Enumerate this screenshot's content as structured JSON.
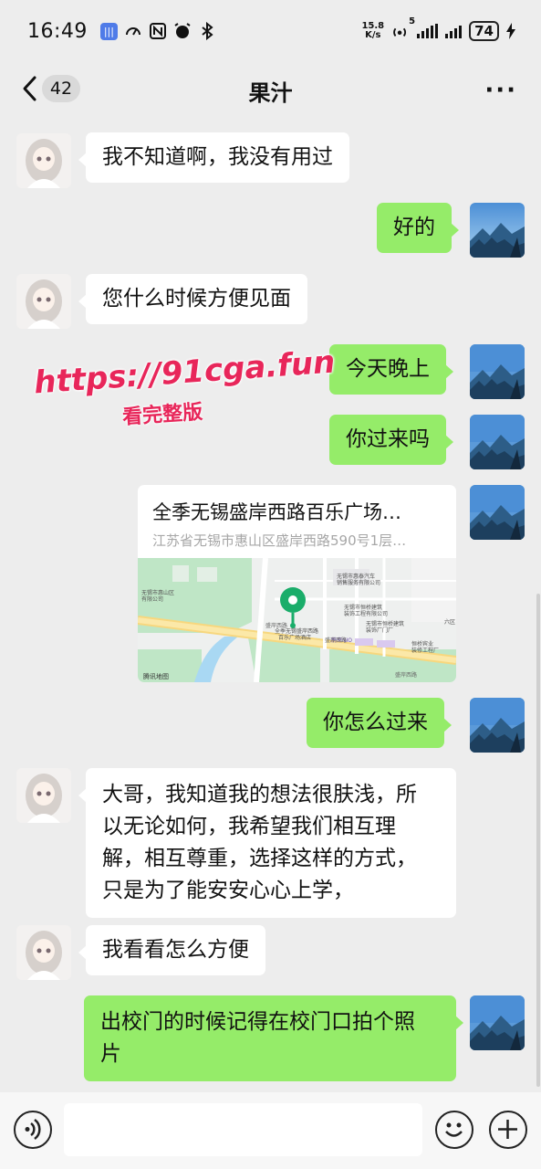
{
  "status_bar": {
    "time": "16:49",
    "net_speed_value": "15.8",
    "net_speed_unit": "K/s",
    "hotspot_count": "5",
    "battery": "74"
  },
  "title_bar": {
    "unread_count": "42",
    "chat_name": "果汁",
    "more_label": "···"
  },
  "messages": [
    {
      "side": "in",
      "text": "我不知道啊，我没有用过"
    },
    {
      "side": "out",
      "text": "好的"
    },
    {
      "side": "in",
      "text": "您什么时候方便见面"
    },
    {
      "side": "out",
      "text": "今天晚上"
    },
    {
      "side": "out",
      "text": "你过来吗"
    },
    {
      "side": "out",
      "type": "location",
      "name": "全季无锡盛岸西路百乐广场…",
      "address": "江苏省无锡市惠山区盛岸西路590号1层…"
    },
    {
      "side": "out",
      "text": "你怎么过来"
    },
    {
      "side": "in",
      "text_lines": [
        "大哥，我知道我的想法很肤浅，所",
        "以无论如何，我希望我们相互理",
        "解，相互尊重，选择这样的方式，",
        "只是为了能安安心心上学，"
      ]
    },
    {
      "side": "in",
      "text": "我看看怎么方便"
    },
    {
      "side": "out",
      "text_lines": [
        "出校门的时候记得在校门口拍个照",
        "片"
      ]
    }
  ],
  "map": {
    "labels": {
      "poi_left": "无锡市惠山区",
      "poi_left_2": "有限公司",
      "poi_top": "无锡市惠泰汽车",
      "poi_top_2": "销售服务有限公司",
      "poi_mid": "无锡市恒桥建筑",
      "poi_mid_2": "装饰工程有限公司",
      "poi_center": "全季无锡盛岸西路",
      "poi_center_2": "百乐广场酒店",
      "neo": "蔚来NIO",
      "poi_right": "无锡市恒桥建筑",
      "poi_right_2": "装饰厂门厂",
      "poi_right3": "恒桥宾业",
      "poi_right3_2": "装修工程厂",
      "road1": "盛岸西路",
      "road2": "盛岸西路",
      "road3": "盛岸西路",
      "corner": "六区",
      "credit": "腾讯地图"
    }
  },
  "watermark": {
    "url": "https://91cga.fun",
    "subtitle": "看完整版"
  },
  "colors": {
    "background": "#ededed",
    "bubble_out": "#95ec69",
    "bubble_in": "#ffffff",
    "map_pin": "#1aad6a",
    "watermark": "#e8265a"
  },
  "icons": {
    "back": "chevron-left-icon",
    "voice": "voice-icon",
    "emoji": "smiley-icon",
    "plus": "plus-icon"
  }
}
